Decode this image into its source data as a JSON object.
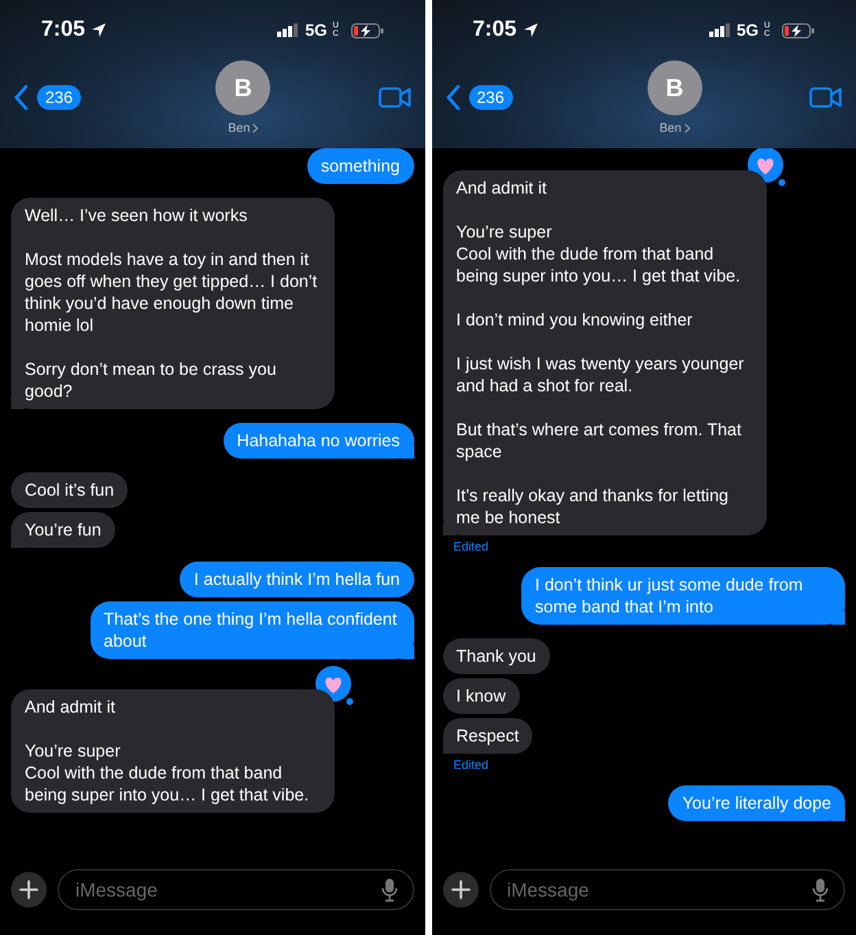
{
  "panels": [
    {
      "status_bar": {
        "time": "7:05",
        "network": "5G",
        "network_sub": "UC"
      },
      "header": {
        "back_count": "236",
        "avatar_letter": "B",
        "name": "Ben"
      },
      "messages": [
        {
          "kind": "sent",
          "text": "something",
          "tail": false
        },
        {
          "kind": "received",
          "text": "Well… I’ve seen how it works\n\nMost models have a toy in and then it goes off when they get tipped… I don’t think you’d have enough down time homie lol\n\nSorry don’t mean to be crass you good?",
          "tail": true
        },
        {
          "kind": "sent",
          "text": "Hahahaha no worries",
          "tail": true
        },
        {
          "kind": "received",
          "text": "Cool it’s fun",
          "tail": false
        },
        {
          "kind": "received",
          "text": "You’re fun",
          "tail": true
        },
        {
          "kind": "sent",
          "text": "I actually think I’m hella fun",
          "tail": false
        },
        {
          "kind": "sent",
          "text": "That’s the one thing I’m hella confident about",
          "tail": true
        },
        {
          "kind": "received",
          "text": "And admit it\n\nYou’re super\nCool with the dude from that band being super into you… I get that vibe.",
          "tail": false,
          "hearted": true
        }
      ],
      "input": {
        "placeholder": "iMessage"
      }
    },
    {
      "status_bar": {
        "time": "7:05",
        "network": "5G",
        "network_sub": "UC"
      },
      "header": {
        "back_count": "236",
        "avatar_letter": "B",
        "name": "Ben"
      },
      "messages": [
        {
          "kind": "received",
          "text": "And admit it\n\nYou’re super\nCool with the dude from that band being super into you… I get that vibe.\n\nI don’t mind you knowing either\n\nI just wish I was twenty years younger and had a shot for real.\n\nBut that’s where art comes from. That space\n\nIt’s really okay and thanks for letting me be honest",
          "tail": true,
          "hearted": true,
          "note": "Edited"
        },
        {
          "kind": "sent",
          "text": "I don’t think ur just some dude from some band that I’m into",
          "tail": true
        },
        {
          "kind": "received",
          "text": "Thank you",
          "tail": false
        },
        {
          "kind": "received",
          "text": "I know",
          "tail": false
        },
        {
          "kind": "received",
          "text": "Respect",
          "tail": true,
          "note": "Edited"
        },
        {
          "kind": "sent",
          "text": "You’re literally dope",
          "tail": true
        }
      ],
      "input": {
        "placeholder": "iMessage"
      }
    }
  ]
}
